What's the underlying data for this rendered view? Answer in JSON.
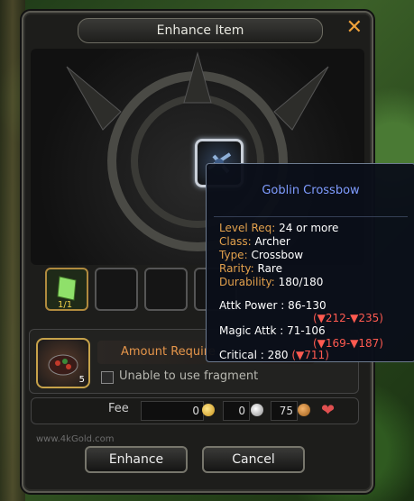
{
  "window": {
    "title": "Enhance Item",
    "close_symbol": "✕"
  },
  "material_slot": {
    "label": "1/1"
  },
  "potion_slot": {
    "count": "5"
  },
  "amount_label": "Amount Require",
  "checkbox_label": "Unable to use fragment",
  "fee": {
    "label": "Fee",
    "gold": "0",
    "silver": "0",
    "copper": "75"
  },
  "watermark": "www.4kGold.com",
  "buttons": {
    "enhance": "Enhance",
    "cancel": "Cancel"
  },
  "tooltip": {
    "title": "Goblin Crossbow",
    "level_req_key": "Level Req:",
    "level_req_val": "24 or more",
    "class_key": "Class:",
    "class_val": "Archer",
    "type_key": "Type:",
    "type_val": "Crossbow",
    "rarity_key": "Rarity:",
    "rarity_val": "Rare",
    "durability_key": "Durability:",
    "durability_val": "180/180",
    "attk_power": "Attk Power : 86-130",
    "attk_power_delta": "(▼212-▼235)",
    "magic_attk": "Magic Attk : 71-106",
    "magic_attk_delta": "(▼169-▼187)",
    "critical": "Critical : 280",
    "critical_delta": "(▼711)"
  },
  "colors": {
    "accent": "#f0a23a",
    "tooltip_title": "#7f9cff",
    "negative": "#ff5a50"
  },
  "icons": [
    "close-icon",
    "crossbow-icon",
    "gem-icon",
    "potion-icon",
    "gold-coin-icon",
    "silver-coin-icon",
    "copper-coin-icon",
    "heart-icon"
  ]
}
